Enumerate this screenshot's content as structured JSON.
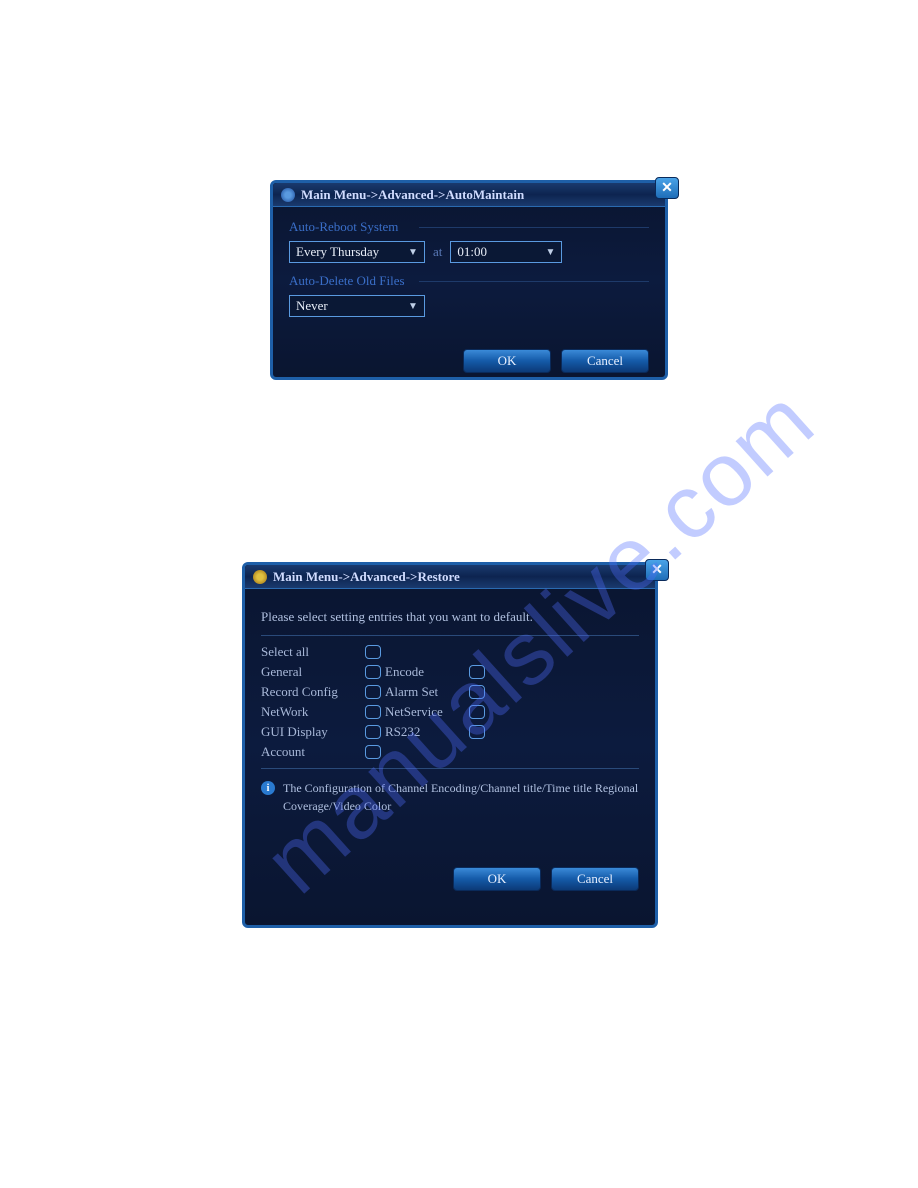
{
  "dialog1": {
    "breadcrumb": "Main Menu->Advanced->AutoMaintain",
    "close_glyph": "✕",
    "section_reboot": "Auto-Reboot System",
    "reboot_day": "Every Thursday",
    "at_label": "at",
    "reboot_time": "01:00",
    "section_delete": "Auto-Delete Old Files",
    "delete_value": "Never",
    "ok_label": "OK",
    "cancel_label": "Cancel"
  },
  "dialog2": {
    "breadcrumb": "Main Menu->Advanced->Restore",
    "close_glyph": "✕",
    "instruction": "Please select setting entries that you want to default.",
    "checks": {
      "select_all": "Select all",
      "general": "General",
      "encode": "Encode",
      "record_config": "Record Config",
      "alarm_set": "Alarm Set",
      "network": "NetWork",
      "netservice": "NetService",
      "gui_display": "GUI Display",
      "rs232": "RS232",
      "account": "Account"
    },
    "info_text": "The Configuration of Channel Encoding/Channel title/Time title Regional Coverage/Video Color",
    "ok_label": "OK",
    "cancel_label": "Cancel"
  },
  "watermark": "manualslive.com"
}
